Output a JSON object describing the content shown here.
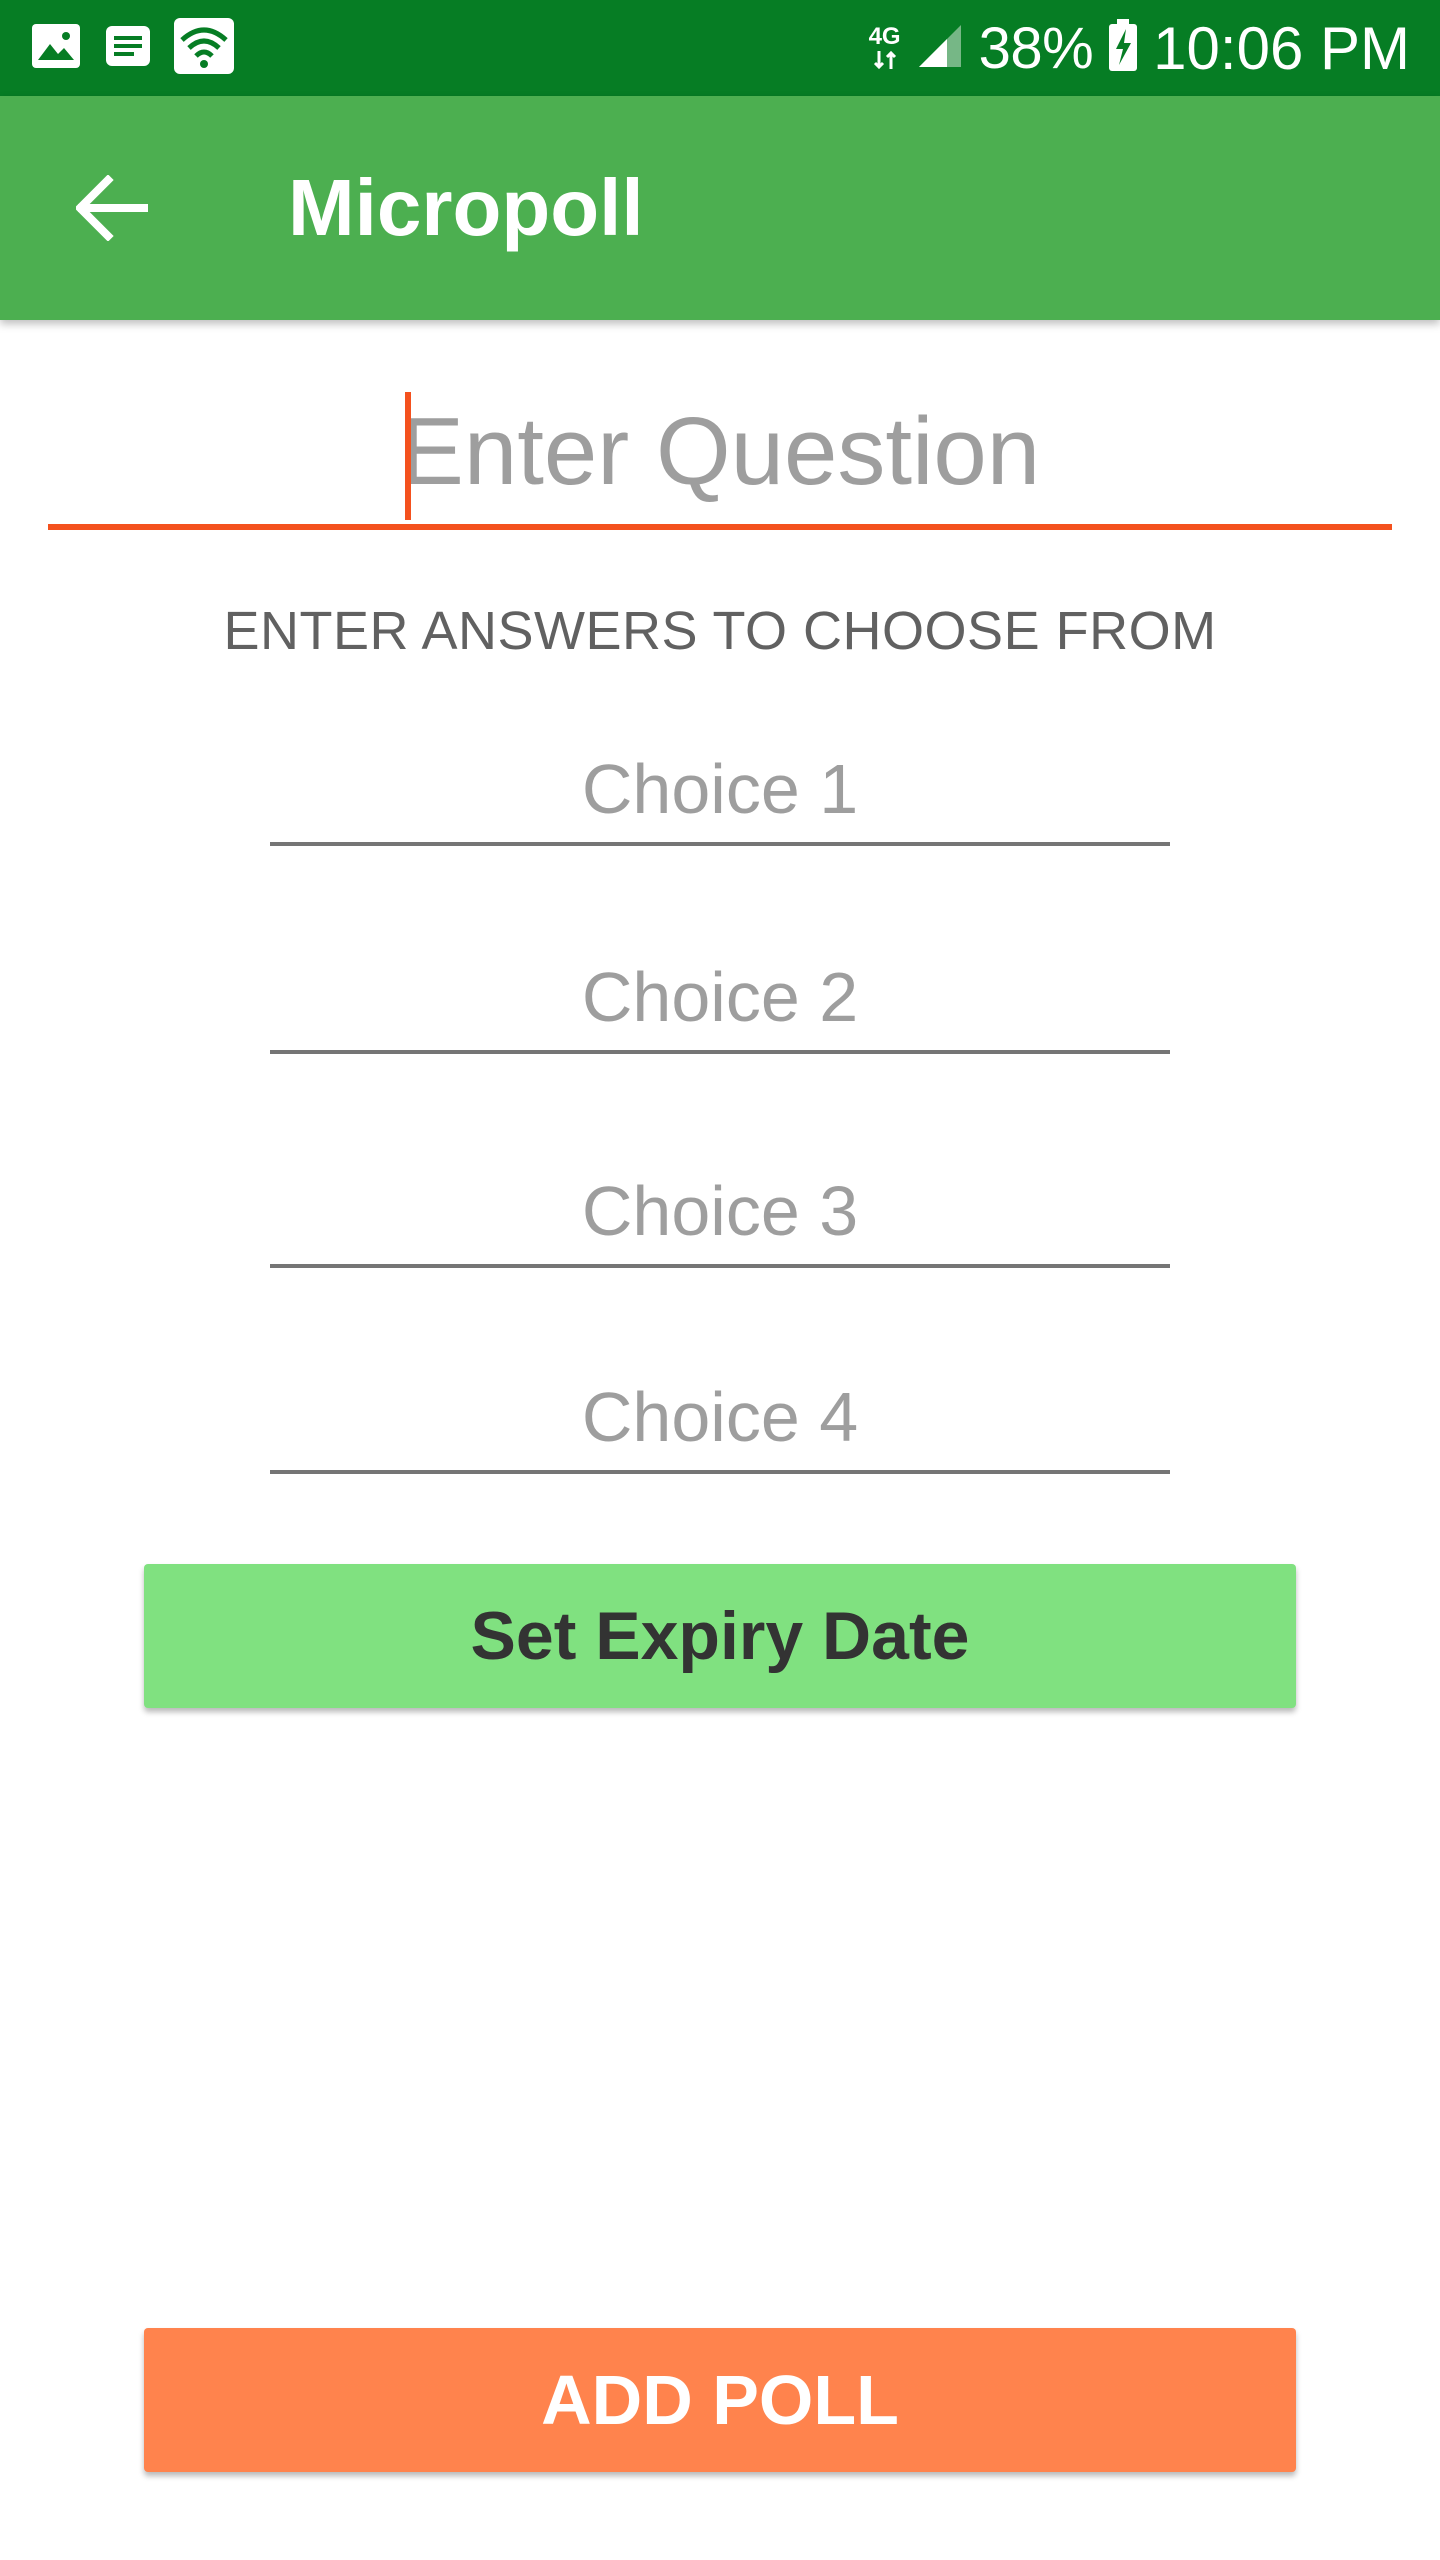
{
  "status_bar": {
    "network_type": "4G",
    "battery": "38%",
    "time": "10:06 PM",
    "left_icons": [
      "gallery-icon",
      "message-icon",
      "wifi-icon"
    ],
    "right_icons": [
      "data-arrows-icon",
      "signal-icon",
      "battery-charging-icon"
    ]
  },
  "app_bar": {
    "title": "Micropoll",
    "back_icon": "back-arrow-icon"
  },
  "form": {
    "question_placeholder": "Enter Question",
    "question_value": "",
    "answers_label": "ENTER ANSWERS TO CHOOSE FROM",
    "choices": [
      {
        "placeholder": "Choice 1",
        "value": ""
      },
      {
        "placeholder": "Choice 2",
        "value": ""
      },
      {
        "placeholder": "Choice 3",
        "value": ""
      },
      {
        "placeholder": "Choice 4",
        "value": ""
      }
    ],
    "expiry_button_label": "Set Expiry Date",
    "add_button_label": "ADD POLL"
  },
  "colors": {
    "status_bar": "#067d24",
    "app_bar": "#4caf50",
    "accent": "#f4511e",
    "expiry_button": "#80e180",
    "add_button": "#ff834d"
  }
}
